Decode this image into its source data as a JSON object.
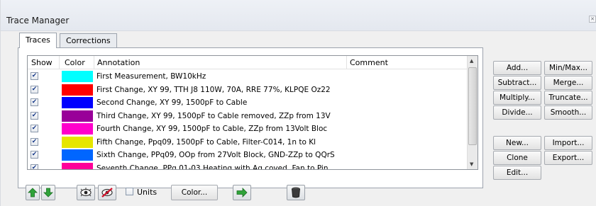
{
  "window": {
    "title": "Trace Manager"
  },
  "tabs": [
    {
      "label": "Traces"
    },
    {
      "label": "Corrections"
    }
  ],
  "columns": {
    "show": "Show",
    "color": "Color",
    "annotation": "Annotation",
    "comment": "Comment"
  },
  "rows": [
    {
      "show": true,
      "color": "#00ffff",
      "annotation": "First Measurement, BW10kHz",
      "comment": ""
    },
    {
      "show": true,
      "color": "#ff0000",
      "annotation": "First Change, XY 99, TTH J8 110W, 70A, RRE 77%, KLPQE Oz22",
      "comment": ""
    },
    {
      "show": true,
      "color": "#0000ff",
      "annotation": "Second Change, XY 99, 1500pF to Cable",
      "comment": ""
    },
    {
      "show": true,
      "color": "#990099",
      "annotation": "Third Change, XY 99, 1500pF to Cable removed, ZZp from 13V",
      "comment": ""
    },
    {
      "show": true,
      "color": "#ff00cc",
      "annotation": "Fourth Change, XY 99, 1500pF to Cable, ZZp from 13Volt Bloc",
      "comment": ""
    },
    {
      "show": true,
      "color": "#e6e600",
      "annotation": "Fifth Change, Ppq09, 1500pF to Cable, Filter-C014, 1n to Kl",
      "comment": ""
    },
    {
      "show": true,
      "color": "#0066ff",
      "annotation": "Sixth Change, PPq09, OOp from 27Volt Block, GND-ZZp to QQrS",
      "comment": ""
    },
    {
      "show": true,
      "color": "#ff0099",
      "annotation": "Seventh Change, PPq 01-03 Heating with Ag coved, Fan to Pin",
      "comment": ""
    }
  ],
  "buttons": {
    "add": "Add...",
    "minmax": "Min/Max...",
    "subtract": "Subtract...",
    "merge": "Merge...",
    "multiply": "Multiply...",
    "truncate": "Truncate...",
    "divide": "Divide...",
    "smooth": "Smooth...",
    "new": "New...",
    "import": "Import...",
    "clone": "Clone",
    "export": "Export...",
    "edit": "Edit..."
  },
  "bottom": {
    "units_label": "Units",
    "units_checked": false,
    "color_button": "Color..."
  },
  "icons": {
    "move_up": "arrow-up-icon",
    "move_down": "arrow-down-icon",
    "show_all": "eye-icon",
    "hide_all": "eye-crossed-icon",
    "apply": "arrow-right-icon",
    "delete": "trash-icon"
  },
  "colors": {
    "arrow_green": "#2fa33a",
    "list_border": "#8f949b"
  }
}
